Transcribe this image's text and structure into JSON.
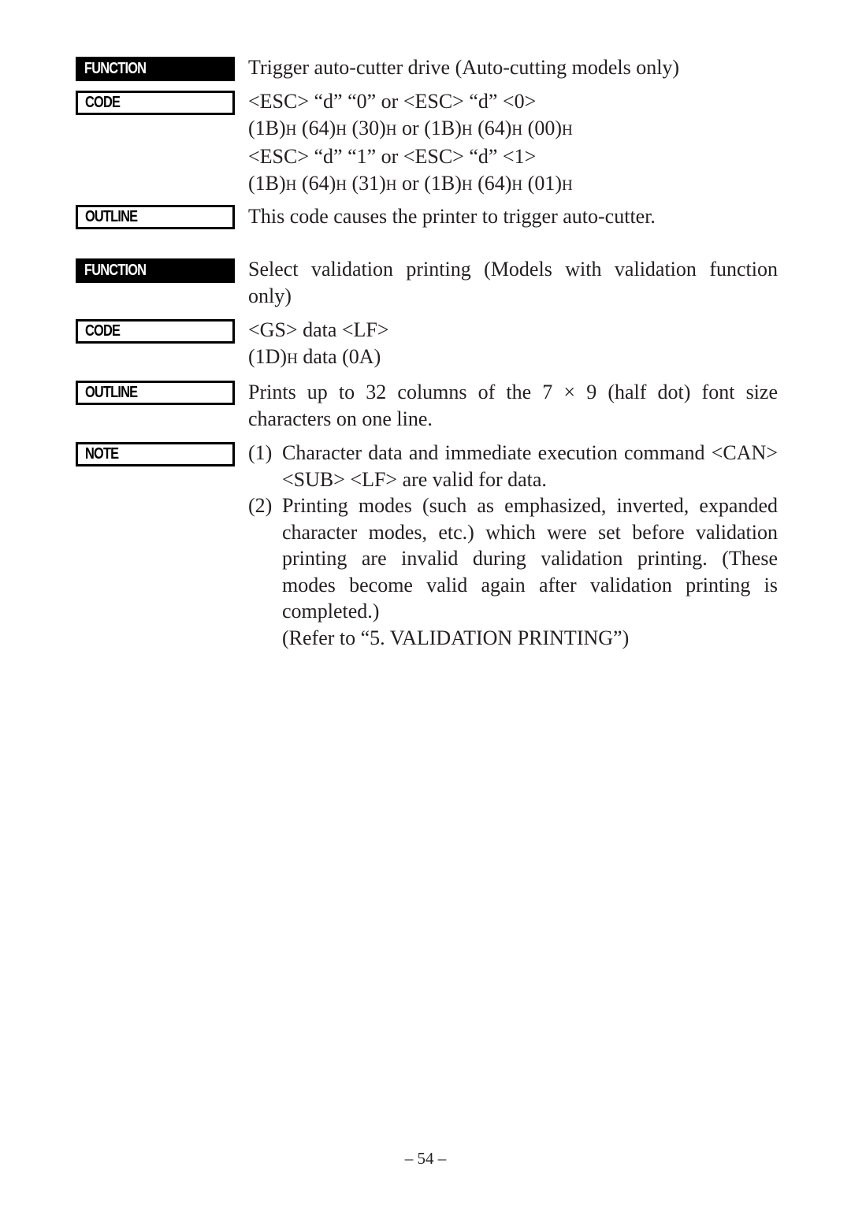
{
  "labels": {
    "function": "FUNCTION",
    "code": "CODE",
    "outline": "OUTLINE",
    "note": "NOTE"
  },
  "sections": [
    {
      "function": "Trigger auto-cutter drive (Auto-cutting models only)",
      "code_lines": [
        {
          "parts": [
            "<ESC> “d” “0” or <ESC> “d” <0>"
          ]
        },
        {
          "parts": [
            "(1B)",
            "H",
            " (64)",
            "H",
            " (30)",
            "H",
            " or (1B)",
            "H",
            " (64)",
            "H",
            " (00)",
            "H"
          ]
        },
        {
          "parts": [
            "<ESC> “d” “1” or <ESC> “d” <1>"
          ]
        },
        {
          "parts": [
            "(1B)",
            "H",
            " (64)",
            "H",
            " (31)",
            "H",
            " or (1B)",
            "H",
            " (64)",
            "H",
            " (01)",
            "H"
          ]
        }
      ],
      "outline": "This code causes the printer  to trigger auto-cutter."
    },
    {
      "function": "Select validation printing (Models with validation function only)",
      "code_lines": [
        {
          "parts": [
            "<GS> data <LF>"
          ]
        },
        {
          "parts": [
            "(1D)",
            "H",
            " data (0A)"
          ]
        }
      ],
      "outline": "Prints up to 32 columns of the 7 × 9 (half dot) font size characters on one line.",
      "notes": [
        {
          "num": "(1)",
          "text": "Character data and immediate execution command <CAN> <SUB> <LF> are valid for data."
        },
        {
          "num": "(2)",
          "text": "Printing modes (such as emphasized, inverted, expanded character modes, etc.) which were set before validation printing are invalid during validation printing. (These modes become valid again after validation printing is completed.)",
          "ref": "(Refer to “5. VALIDATION PRINTING”)"
        }
      ]
    }
  ],
  "footer": {
    "page_number": "– 54 –"
  }
}
